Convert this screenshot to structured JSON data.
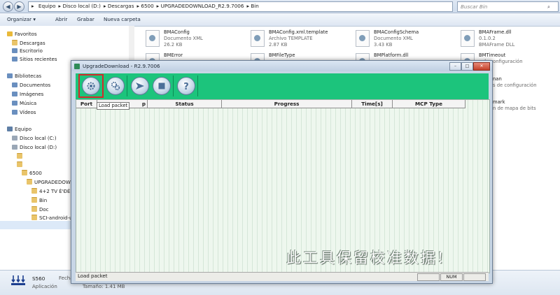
{
  "explorer": {
    "breadcrumbs": [
      "Equipo",
      "Disco local (D:)",
      "Descargas",
      "6500",
      "UPGRADEDOWNLOAD_R2.9.7006",
      "Bin"
    ],
    "search_placeholder": "Buscar Bin",
    "commands": [
      "Organizar ▾",
      "Abrir",
      "Grabar",
      "Nueva carpeta"
    ],
    "nav": {
      "favorites": "Favoritos",
      "fav_items": [
        "Descargas",
        "Escritorio",
        "Sitios recientes"
      ],
      "libraries": "Bibliotecas",
      "lib_items": [
        "Documentos",
        "Imágenes",
        "Música",
        "Vídeos"
      ],
      "computer": "Equipo",
      "drives": [
        "Disco local (C:)",
        "Disco local (D:)"
      ],
      "folders": [
        "6500",
        "UPGRADEDOWNL",
        "4+2 TV È'ĐĖ¹",
        "Bin",
        "Doc",
        "SCI-android-usb"
      ]
    },
    "files": [
      {
        "name": "BMAConfig",
        "type": "Documento XML",
        "size": "26.2 KB"
      },
      {
        "name": "BMAConfig.xml.template",
        "type": "Archivo TEMPLATE",
        "size": "2.87 KB"
      },
      {
        "name": "BMAConfigSchema",
        "type": "Documento XML",
        "size": "3.43 KB"
      },
      {
        "name": "BMAFrame.dll",
        "type": "Extensión de la aplicación",
        "size": ""
      },
      {
        "name": "BMError",
        "type": "",
        "size": ""
      },
      {
        "name": "BMFileType",
        "type": "",
        "size": ""
      },
      {
        "name": "BMPlatform.dll",
        "type": "",
        "size": ""
      },
      {
        "name": "BMTimeout",
        "type": "",
        "size": ""
      }
    ],
    "right_fragments": [
      "0.1.0.2",
      "BMAFrame DLL",
      "s de configuración",
      "nan",
      "s de configuración",
      "mark",
      "n de mapa de bits"
    ],
    "status": {
      "name": "S560",
      "fecha_label": "Fecha",
      "app_label": "Aplicación",
      "size": "Tamaño: 1.41 MB"
    }
  },
  "app": {
    "title": "UpgradeDownload - R2.9.7006",
    "window_buttons": [
      "–",
      "□",
      "✕"
    ],
    "toolbar": [
      {
        "name": "load-packet",
        "icon": "gear-icon"
      },
      {
        "name": "settings",
        "icon": "gears-icon"
      },
      {
        "name": "start",
        "icon": "play-icon"
      },
      {
        "name": "stop",
        "icon": "stop-icon"
      },
      {
        "name": "help",
        "icon": "help-icon"
      }
    ],
    "columns": [
      "Port",
      "p",
      "Status",
      "Progress",
      "Time[s]",
      "MCP Type"
    ],
    "tooltip": "Load packet",
    "watermark": "此工具保留校准数据!",
    "status_text": "Load packet",
    "num": "NUM"
  },
  "colors": {
    "toolbar": "#1cc47c",
    "grid": "#eef7ee",
    "highlight": "#d6292b"
  }
}
